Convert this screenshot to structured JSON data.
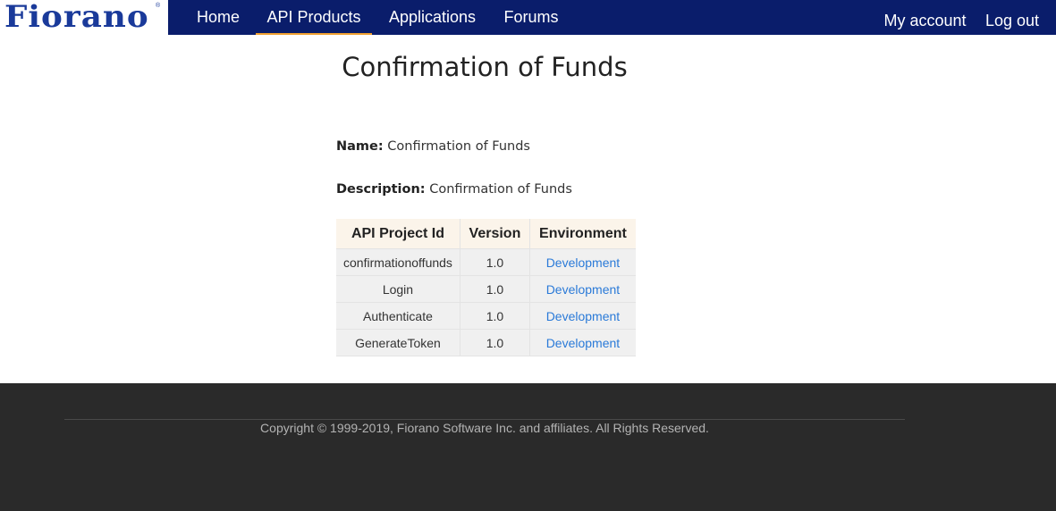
{
  "brand": {
    "logo_text": "Fiorano",
    "logo_mark": "®",
    "nav_bg": "#0a1d6b",
    "accent": "#f0a030",
    "link_color": "#2a7ad8"
  },
  "nav": {
    "home": "Home",
    "api_products": "API Products",
    "applications": "Applications",
    "forums": "Forums",
    "my_account": "My account",
    "log_out": "Log out",
    "active": "API Products"
  },
  "page": {
    "title": "Confirmation of Funds",
    "name_label": "Name:",
    "name_value": "Confirmation of Funds",
    "description_label": "Description:",
    "description_value": "Confirmation of Funds"
  },
  "table": {
    "headers": [
      "API Project Id",
      "Version",
      "Environment"
    ],
    "rows": [
      {
        "project_id": "confirmationoffunds",
        "version": "1.0",
        "environment": "Development"
      },
      {
        "project_id": "Login",
        "version": "1.0",
        "environment": "Development"
      },
      {
        "project_id": "Authenticate",
        "version": "1.0",
        "environment": "Development"
      },
      {
        "project_id": "GenerateToken",
        "version": "1.0",
        "environment": "Development"
      }
    ]
  },
  "footer": {
    "copyright": "Copyright © 1999-2019, Fiorano Software Inc. and affiliates. All Rights Reserved."
  }
}
